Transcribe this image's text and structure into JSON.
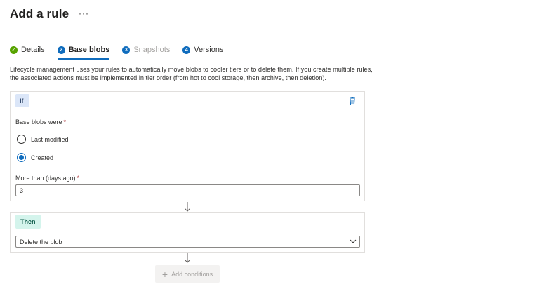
{
  "header": {
    "title": "Add a rule",
    "more_label": "···"
  },
  "tabs": [
    {
      "marker": "✓",
      "label": "Details",
      "state": "done"
    },
    {
      "marker": "2",
      "label": "Base blobs",
      "state": "active"
    },
    {
      "marker": "3",
      "label": "Snapshots",
      "state": "disabled"
    },
    {
      "marker": "4",
      "label": "Versions",
      "state": "default"
    }
  ],
  "description": "Lifecycle management uses your rules to automatically move blobs to cooler tiers or to delete them. If you create multiple rules, the associated actions must be implemented in tier order (from hot to cool storage, then archive, then deletion).",
  "if_card": {
    "chip": "If",
    "base_blobs_label": "Base blobs were",
    "required_marker": "*",
    "options": [
      {
        "label": "Last modified",
        "checked": false
      },
      {
        "label": "Created",
        "checked": true
      }
    ],
    "days_label": "More than (days ago)",
    "days_value": "3"
  },
  "then_card": {
    "chip": "Then",
    "action_value": "Delete the blob"
  },
  "add_conditions": {
    "plus": "+",
    "label": "Add conditions"
  },
  "colors": {
    "accent": "#0f6cbd",
    "done": "#57a300",
    "if_chip_bg": "#dbe6f8",
    "then_chip_bg": "#d4f4ec"
  }
}
